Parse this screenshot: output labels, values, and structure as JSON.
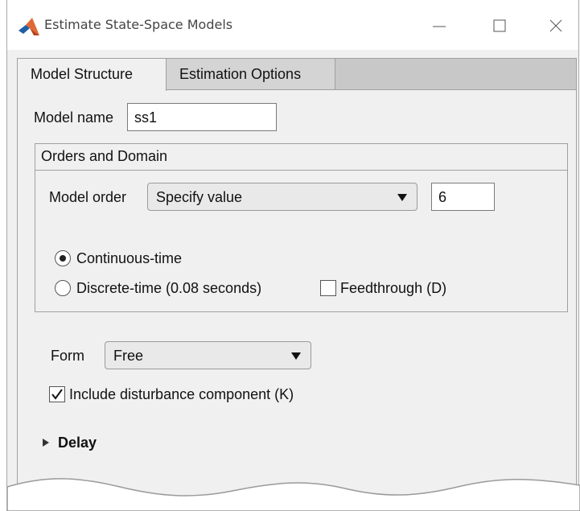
{
  "window": {
    "title": "Estimate State-Space Models"
  },
  "tabs": [
    {
      "label": "Model Structure",
      "active": true
    },
    {
      "label": "Estimation Options",
      "active": false
    }
  ],
  "model_name": {
    "label": "Model name",
    "value": "ss1"
  },
  "orders_domain": {
    "header": "Orders and Domain",
    "model_order_label": "Model order",
    "model_order_selected": "Specify value",
    "model_order_value": "6",
    "continuous_label": "Continuous-time",
    "continuous_selected": true,
    "discrete_label": "Discrete-time (0.08 seconds)",
    "discrete_selected": false,
    "feedthrough_label": "Feedthrough (D)",
    "feedthrough_checked": false
  },
  "form": {
    "label": "Form",
    "selected": "Free"
  },
  "disturbance": {
    "label": "Include disturbance component (K)",
    "checked": true
  },
  "delay": {
    "label": "Delay"
  },
  "colors": {
    "tab_strip": "#c8c8c8",
    "panel_bg": "#f0f0f0",
    "matlab_orange": "#e16737",
    "matlab_blue": "#1f5ea8"
  }
}
